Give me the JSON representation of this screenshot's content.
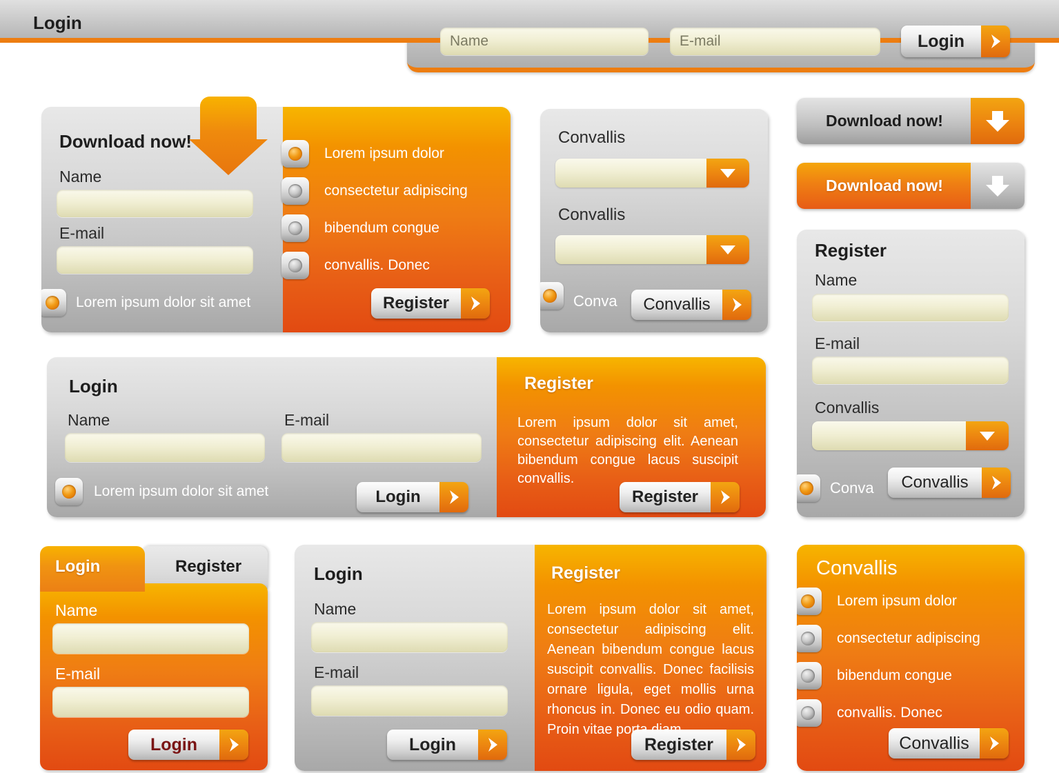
{
  "header": {
    "title": "Login",
    "name_placeholder": "Name",
    "email_placeholder": "E-mail",
    "login_label": "Login"
  },
  "download_panel": {
    "title": "Download now!",
    "name_label": "Name",
    "email_label": "E-mail",
    "consent_label": "Lorem ipsum dolor sit  amet",
    "options": [
      "Lorem   ipsum   dolor",
      "consectetur adipiscing",
      "bibendum  congue",
      "convallis.  Donec"
    ],
    "register_label": "Register"
  },
  "convallis_panel": {
    "label_1": "Convallis",
    "label_2": "Convallis",
    "radio_label": "Conva",
    "button_label": "Convallis"
  },
  "download_buttons": [
    {
      "label": "Download now!",
      "style": "grey"
    },
    {
      "label": "Download now!",
      "style": "orange"
    }
  ],
  "register_panel": {
    "title": "Register",
    "name_label": "Name",
    "email_label": "E-mail",
    "convallis_label": "Convallis",
    "radio_label": "Conva",
    "button_label": "Convallis"
  },
  "wide_panel": {
    "login_title": "Login",
    "name_label": "Name",
    "email_label": "E-mail",
    "consent_label": "Lorem ipsum dolor sit  amet",
    "login_button": "Login",
    "register_title": "Register",
    "register_body": "Lorem ipsum dolor sit amet, consectetur adipiscing elit. Aenean bibendum congue lacus suscipit convallis.",
    "register_button": "Register"
  },
  "tab_panel": {
    "tab_login": "Login",
    "tab_register": "Register",
    "name_label": "Name",
    "email_label": "E-mail",
    "login_button": "Login"
  },
  "login_register_panel": {
    "login_title": "Login",
    "name_label": "Name",
    "email_label": "E-mail",
    "login_button": "Login",
    "register_title": "Register",
    "register_body": "Lorem ipsum dolor sit amet, consectetur adipiscing elit. Aenean bibendum congue lacus suscipit convallis. Donec facilisis ornare ligula, eget mollis urna rhoncus in. Donec eu odio quam. Proin vitae porta diam.",
    "register_button": "Register"
  },
  "convallis_list_panel": {
    "title": "Convallis",
    "options": [
      "Lorem   ipsum   dolor",
      "consectetur adipiscing",
      "bibendum  congue",
      "convallis.  Donec"
    ],
    "button_label": "Convallis"
  },
  "colors": {
    "orange": "#ed7d11",
    "orange_deep": "#e24a12",
    "orange_light": "#f7b500",
    "grey": "#bdbdbd",
    "cream": "#f1efd4",
    "maroon": "#7a1414"
  }
}
